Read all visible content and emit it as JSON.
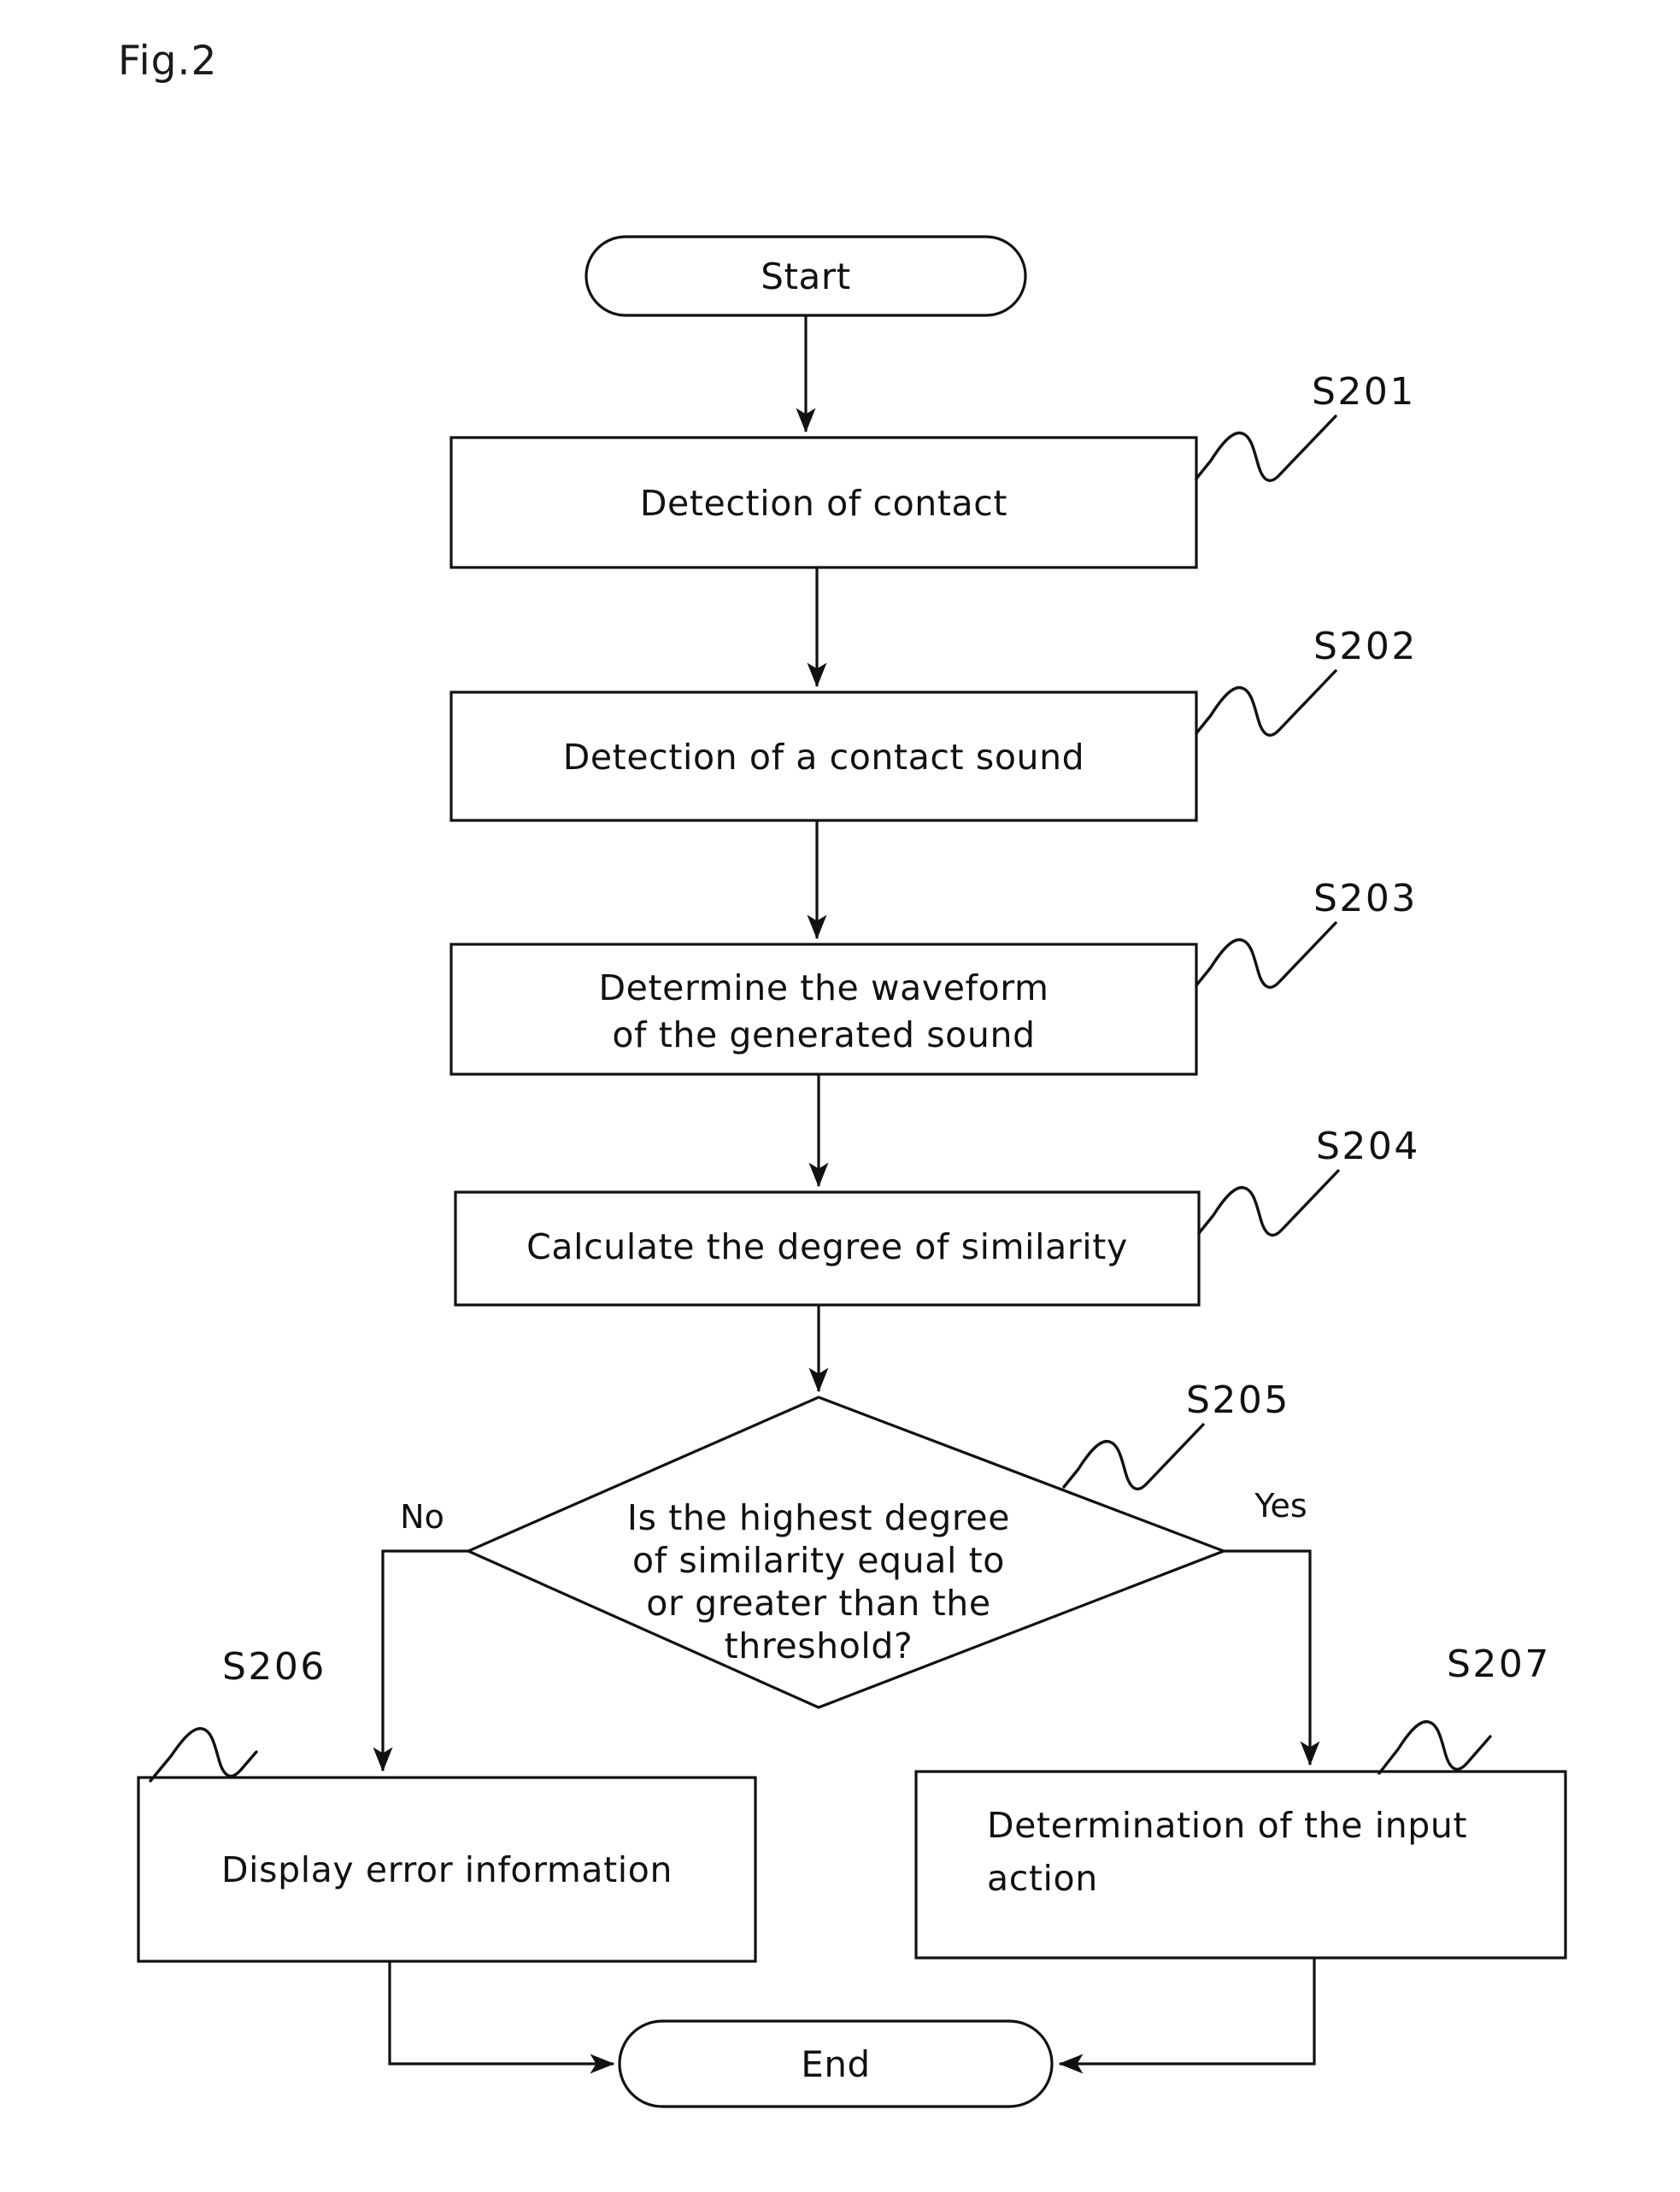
{
  "figure": {
    "label": "Fig.2"
  },
  "flowchart": {
    "type": "flowchart",
    "nodes": [
      {
        "id": "start",
        "shape": "terminator",
        "text": "Start"
      },
      {
        "id": "s201",
        "shape": "process",
        "text": "Detection of contact",
        "step": "S201"
      },
      {
        "id": "s202",
        "shape": "process",
        "text": "Detection of a contact sound",
        "step": "S202"
      },
      {
        "id": "s203",
        "shape": "process",
        "line1": "Determine the waveform",
        "line2": "of the generated sound",
        "step": "S203"
      },
      {
        "id": "s204",
        "shape": "process",
        "text": "Calculate the degree of similarity",
        "step": "S204"
      },
      {
        "id": "s205",
        "shape": "decision",
        "line1": "Is the highest degree",
        "line2": "of similarity equal to",
        "line3": "or greater than the",
        "line4": "threshold?",
        "step": "S205"
      },
      {
        "id": "s206",
        "shape": "process",
        "text": "Display error information",
        "step": "S206"
      },
      {
        "id": "s207",
        "shape": "process",
        "line1": "Determination of the input",
        "line2": "action",
        "step": "S207"
      },
      {
        "id": "end",
        "shape": "terminator",
        "text": "End"
      }
    ],
    "edge_labels": {
      "no": "No",
      "yes": "Yes"
    }
  },
  "colors": {
    "ink": "#111111",
    "paper": "#ffffff"
  }
}
